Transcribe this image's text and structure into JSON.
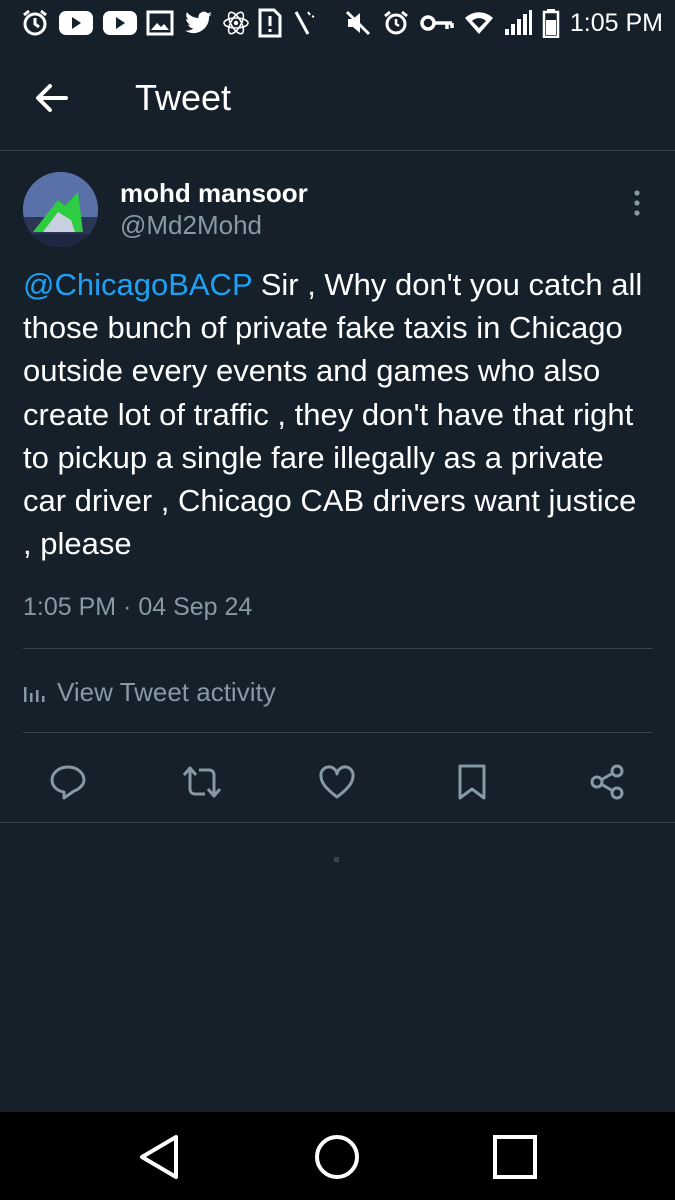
{
  "status_bar": {
    "time": "1:05 PM",
    "left_icons": [
      "alarm-icon",
      "youtube-icon",
      "youtube-icon",
      "gallery-icon",
      "twitter-icon",
      "react-icon",
      "sim-alert-icon",
      "wand-icon"
    ],
    "right_icons": [
      "mute-icon",
      "alarm-icon",
      "vpn-key-icon",
      "wifi-icon",
      "signal-icon",
      "battery-icon"
    ]
  },
  "header": {
    "title": "Tweet",
    "back_icon": "arrow-left-icon"
  },
  "tweet": {
    "author_name": "mohd mansoor",
    "author_handle": "@Md2Mohd",
    "mention": "@ChicagoBACP",
    "body": " Sir , Why don't you catch all those bunch of private fake taxis in Chicago outside every events and games who also create lot of traffic , they don't have that right to pickup a single fare illegally as a private car driver , Chicago CAB drivers want justice , please",
    "timestamp": "1:05 PM · 04 Sep 24",
    "activity_label": "View Tweet activity",
    "actions": [
      "reply-icon",
      "retweet-icon",
      "like-icon",
      "bookmark-icon",
      "share-icon"
    ]
  },
  "nav_bar": {
    "buttons": [
      "back-triangle-icon",
      "home-circle-icon",
      "recents-square-icon"
    ]
  },
  "colors": {
    "background": "#15202b",
    "accent": "#1da1f2",
    "secondary_text": "#8899a6",
    "divider": "#38444d"
  }
}
